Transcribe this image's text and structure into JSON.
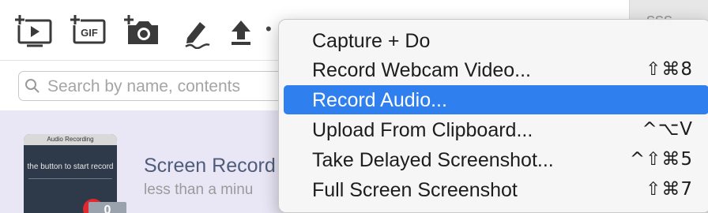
{
  "background_window": {
    "text": "sss"
  },
  "toolbar": {
    "buttons": [
      {
        "icon": "add-screen-recording-icon"
      },
      {
        "icon": "add-gif-icon",
        "text": "GIF"
      },
      {
        "icon": "add-screenshot-icon"
      },
      {
        "icon": "annotate-pen-icon"
      },
      {
        "icon": "upload-icon"
      }
    ],
    "more": "•"
  },
  "search": {
    "placeholder": "Search by name, contents"
  },
  "list": {
    "items": [
      {
        "thumb_title": "Audio Recording",
        "thumb_text": "the button to start record",
        "title": "Screen Record",
        "subtitle": "less than a minu",
        "count": "0"
      }
    ]
  },
  "menu": {
    "items": [
      {
        "label": "Capture + Do",
        "shortcut": ""
      },
      {
        "label": "Record Webcam Video...",
        "shortcut": "⇧⌘8"
      },
      {
        "label": "Record Audio...",
        "shortcut": "",
        "selected": true
      },
      {
        "label": "Upload From Clipboard...",
        "shortcut": "^⌥V"
      },
      {
        "label": "Take Delayed Screenshot...",
        "shortcut": "^⇧⌘5"
      },
      {
        "label": "Full Screen Screenshot",
        "shortcut": "⇧⌘7"
      }
    ]
  },
  "colors": {
    "accent": "#2f7fef",
    "list_bg": "#e9e6f5",
    "icon": "#3a3a3a"
  }
}
